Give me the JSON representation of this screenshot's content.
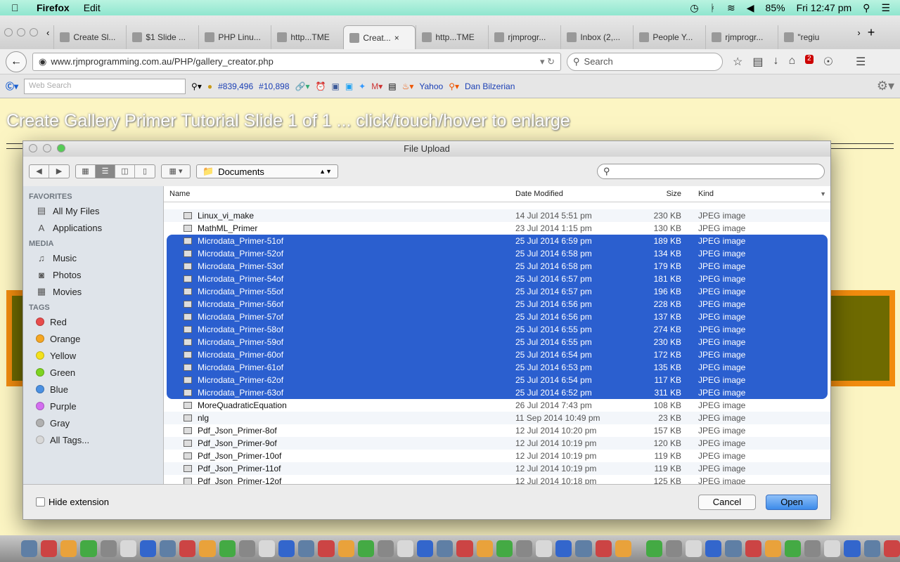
{
  "menubar": {
    "app": "Firefox",
    "menu": [
      "Edit"
    ],
    "battery": "85%",
    "clock": "Fri 12:47 pm"
  },
  "tabs": [
    {
      "label": "Create Sl..."
    },
    {
      "label": "$1 Slide ..."
    },
    {
      "label": "PHP Linu..."
    },
    {
      "label": "http...TME"
    },
    {
      "label": "Creat...",
      "active": true
    },
    {
      "label": "http...TME"
    },
    {
      "label": "rjmprogr..."
    },
    {
      "label": "Inbox (2,..."
    },
    {
      "label": "People Y..."
    },
    {
      "label": "rjmprogr..."
    },
    {
      "label": "\"regiu"
    }
  ],
  "nav": {
    "url": "www.rjmprogramming.com.au/PHP/gallery_creator.php",
    "search_placeholder": "Search",
    "badge": "2"
  },
  "bookmarks": {
    "web_search_placeholder": "Web Search",
    "rank1": "#839,496",
    "rank2": "#10,898",
    "yahoo": "Yahoo",
    "dan": "Dan Bilzerian"
  },
  "page": {
    "title": "Create Gallery Primer Tutorial Slide 1 of 1 ... click/touch/hover to enlarge"
  },
  "dialog": {
    "title": "File Upload",
    "location": "Documents",
    "search_value": "",
    "sidebar": [
      {
        "heading": "FAVORITES",
        "items": [
          {
            "label": "All My Files",
            "icon": "all-files-icon"
          },
          {
            "label": "Applications",
            "icon": "applications-icon"
          }
        ]
      },
      {
        "heading": "MEDIA",
        "items": [
          {
            "label": "Music",
            "icon": "music-icon"
          },
          {
            "label": "Photos",
            "icon": "camera-icon"
          },
          {
            "label": "Movies",
            "icon": "film-icon"
          }
        ]
      },
      {
        "heading": "TAGS",
        "items": [
          {
            "label": "Red",
            "color": "#e84c4c"
          },
          {
            "label": "Orange",
            "color": "#f5a623"
          },
          {
            "label": "Yellow",
            "color": "#f4e11c"
          },
          {
            "label": "Green",
            "color": "#7ed321"
          },
          {
            "label": "Blue",
            "color": "#4a90e2"
          },
          {
            "label": "Purple",
            "color": "#d36ef0"
          },
          {
            "label": "Gray",
            "color": "#b0b0b0"
          },
          {
            "label": "All Tags...",
            "color": "#d8d8d8"
          }
        ]
      }
    ],
    "columns": [
      "Name",
      "Date Modified",
      "Size",
      "Kind"
    ],
    "files": [
      [
        "Linux_vi_make",
        "14 Jul 2014 5:51 pm",
        "230 KB",
        "JPEG image",
        false
      ],
      [
        "MathML_Primer",
        "23 Jul 2014 1:15 pm",
        "130 KB",
        "JPEG image",
        false
      ],
      [
        "Microdata_Primer-51of",
        "25 Jul 2014 6:59 pm",
        "189 KB",
        "JPEG image",
        true
      ],
      [
        "Microdata_Primer-52of",
        "25 Jul 2014 6:58 pm",
        "134 KB",
        "JPEG image",
        true
      ],
      [
        "Microdata_Primer-53of",
        "25 Jul 2014 6:58 pm",
        "179 KB",
        "JPEG image",
        true
      ],
      [
        "Microdata_Primer-54of",
        "25 Jul 2014 6:57 pm",
        "181 KB",
        "JPEG image",
        true
      ],
      [
        "Microdata_Primer-55of",
        "25 Jul 2014 6:57 pm",
        "196 KB",
        "JPEG image",
        true
      ],
      [
        "Microdata_Primer-56of",
        "25 Jul 2014 6:56 pm",
        "228 KB",
        "JPEG image",
        true
      ],
      [
        "Microdata_Primer-57of",
        "25 Jul 2014 6:56 pm",
        "137 KB",
        "JPEG image",
        true
      ],
      [
        "Microdata_Primer-58of",
        "25 Jul 2014 6:55 pm",
        "274 KB",
        "JPEG image",
        true
      ],
      [
        "Microdata_Primer-59of",
        "25 Jul 2014 6:55 pm",
        "230 KB",
        "JPEG image",
        true
      ],
      [
        "Microdata_Primer-60of",
        "25 Jul 2014 6:54 pm",
        "172 KB",
        "JPEG image",
        true
      ],
      [
        "Microdata_Primer-61of",
        "25 Jul 2014 6:53 pm",
        "135 KB",
        "JPEG image",
        true
      ],
      [
        "Microdata_Primer-62of",
        "25 Jul 2014 6:54 pm",
        "117 KB",
        "JPEG image",
        true
      ],
      [
        "Microdata_Primer-63of",
        "25 Jul 2014 6:52 pm",
        "311 KB",
        "JPEG image",
        true
      ],
      [
        "MoreQuadraticEquation",
        "26 Jul 2014 7:43 pm",
        "108 KB",
        "JPEG image",
        false
      ],
      [
        "nlg",
        "11 Sep 2014 10:49 pm",
        "23 KB",
        "JPEG image",
        false
      ],
      [
        "Pdf_Json_Primer-8of",
        "12 Jul 2014 10:20 pm",
        "157 KB",
        "JPEG image",
        false
      ],
      [
        "Pdf_Json_Primer-9of",
        "12 Jul 2014 10:19 pm",
        "120 KB",
        "JPEG image",
        false
      ],
      [
        "Pdf_Json_Primer-10of",
        "12 Jul 2014 10:19 pm",
        "119 KB",
        "JPEG image",
        false
      ],
      [
        "Pdf_Json_Primer-11of",
        "12 Jul 2014 10:19 pm",
        "119 KB",
        "JPEG image",
        false
      ],
      [
        "Pdf_Json_Primer-12of",
        "12 Jul 2014 10:18 pm",
        "125 KB",
        "JPEG image",
        false
      ]
    ],
    "hide_extension": "Hide extension",
    "cancel": "Cancel",
    "open": "Open"
  },
  "colors": {
    "selection": "#2b5fcf",
    "page_bg": "#fcf5c3",
    "orange": "#f28c0e"
  }
}
